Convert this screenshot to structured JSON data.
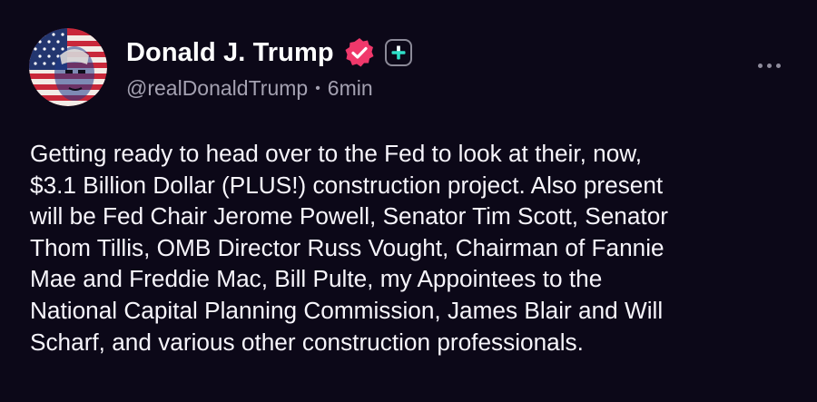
{
  "post": {
    "author": {
      "display_name": "Donald J. Trump",
      "handle": "@realDonaldTrump",
      "avatar_icon": "flag-portrait-avatar",
      "verified_icon": "verified-badge-icon",
      "verified_color": "#f0386b",
      "follow_icon": "plus-icon",
      "follow_color": "#2ee0c8"
    },
    "separator": "•",
    "time_ago": "6min",
    "more_icon": "more-horizontal-icon",
    "lines": [
      "Getting ready to head over to the Fed to look at their, now,",
      "$3.1 Billion Dollar (PLUS!) construction project. Also present",
      "will be Fed Chair Jerome Powell, Senator Tim Scott, Senator",
      "Thom Tillis, OMB Director Russ Vought, Chairman of Fannie",
      "Mae and Freddie Mac, Bill Pulte, my Appointees to the",
      "National Capital Planning Commission, James Blair and Will",
      "Scharf, and various other construction professionals."
    ]
  }
}
